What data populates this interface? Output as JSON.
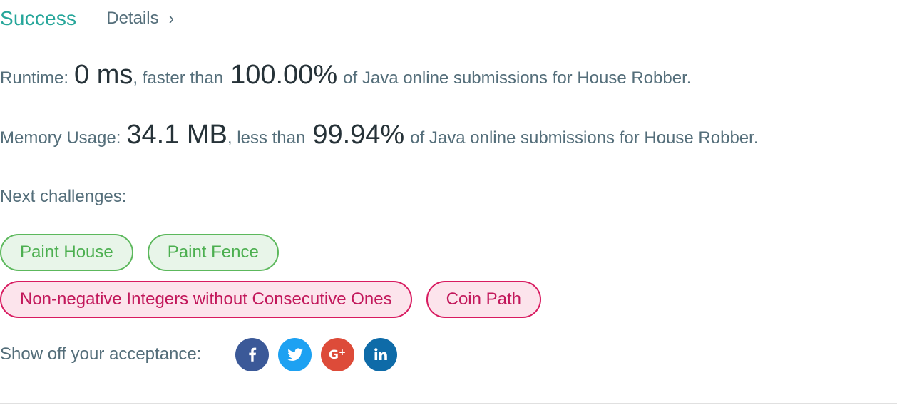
{
  "header": {
    "status": "Success",
    "details_label": "Details",
    "details_chevron": "›"
  },
  "runtime": {
    "label": "Runtime:",
    "value": "0 ms",
    "comparison": ", faster than",
    "percent": "100.00%",
    "suffix": "of Java online submissions for House Robber."
  },
  "memory": {
    "label": "Memory Usage:",
    "value": "34.1 MB",
    "comparison": ", less than",
    "percent": "99.94%",
    "suffix": "of Java online submissions for House Robber."
  },
  "next_challenges": {
    "label": "Next challenges:",
    "items": [
      {
        "label": "Paint House",
        "difficulty": "easy"
      },
      {
        "label": "Paint Fence",
        "difficulty": "easy"
      },
      {
        "label": "Non-negative Integers without Consecutive Ones",
        "difficulty": "hard"
      },
      {
        "label": "Coin Path",
        "difficulty": "hard"
      }
    ]
  },
  "share": {
    "label": "Show off your acceptance:",
    "icons": [
      {
        "name": "facebook-icon",
        "color": "#3b5998"
      },
      {
        "name": "twitter-icon",
        "color": "#1da1f2"
      },
      {
        "name": "google-plus-icon",
        "color": "#dd4b39"
      },
      {
        "name": "linkedin-icon",
        "color": "#0e6ba8"
      }
    ]
  },
  "colors": {
    "success": "#26a69a",
    "easy_border": "#5cb85c",
    "easy_bg": "#e8f5e9",
    "hard_border": "#d81b60",
    "hard_bg": "#fce4ec"
  }
}
